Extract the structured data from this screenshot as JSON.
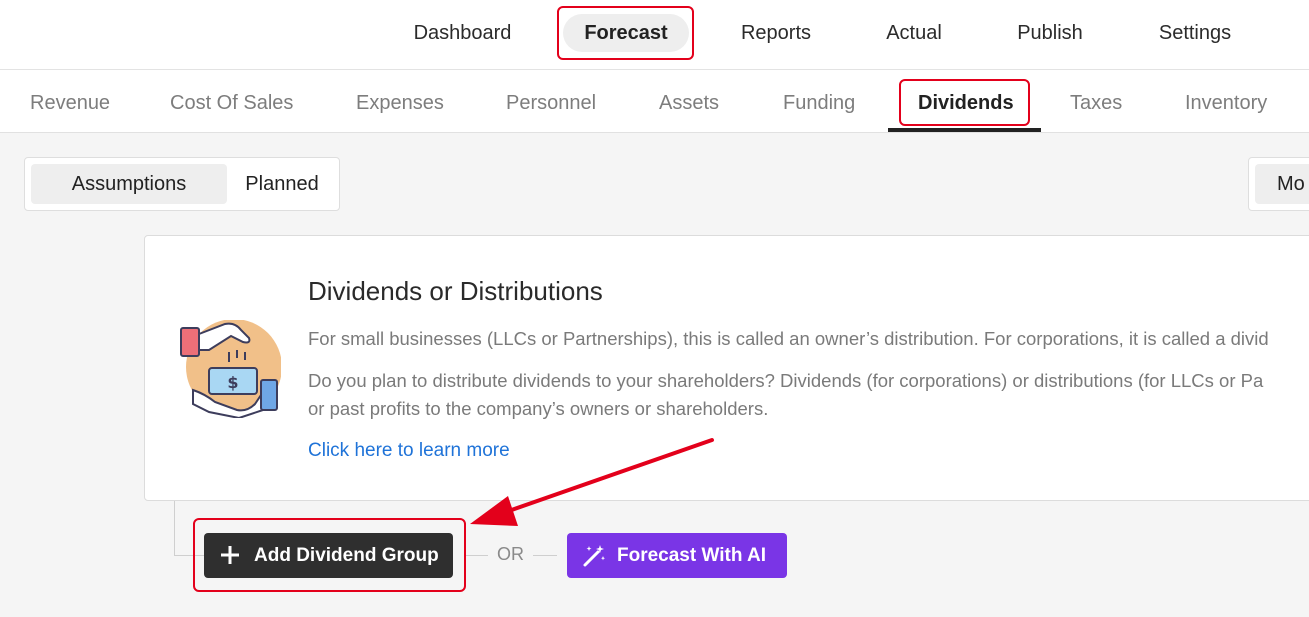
{
  "top_nav": {
    "items": [
      {
        "label": "Dashboard"
      },
      {
        "label": "Forecast",
        "active": true
      },
      {
        "label": "Reports"
      },
      {
        "label": "Actual"
      },
      {
        "label": "Publish"
      },
      {
        "label": "Settings"
      }
    ]
  },
  "sub_nav": {
    "items": [
      {
        "label": "Revenue"
      },
      {
        "label": "Cost Of Sales"
      },
      {
        "label": "Expenses"
      },
      {
        "label": "Personnel"
      },
      {
        "label": "Assets"
      },
      {
        "label": "Funding"
      },
      {
        "label": "Dividends",
        "active": true
      },
      {
        "label": "Taxes"
      },
      {
        "label": "Inventory"
      }
    ]
  },
  "view_toggle": {
    "active_label": "Assumptions",
    "other_label": "Planned"
  },
  "right_toggle": {
    "label": "Mo"
  },
  "info_card": {
    "title": "Dividends or Distributions",
    "desc_line1": "For small businesses (LLCs or Partnerships), this is called an owner’s distribution. For corporations, it is called a divid",
    "desc_line2": "Do you plan to distribute dividends to your shareholders? Dividends (for corporations) or distributions (for LLCs or Pa",
    "desc_line3": "or past profits to the company’s owners or shareholders.",
    "learn_more": "Click here to learn more",
    "illustration_icon": "money-hand-icon"
  },
  "actions": {
    "add_label": "Add Dividend Group",
    "or_label": "OR",
    "ai_label": "Forecast With AI"
  },
  "colors": {
    "accent_purple": "#7a35e6",
    "dark_button": "#2f2f2f",
    "link_blue": "#1f73d8",
    "highlight_red": "#e3001b"
  }
}
